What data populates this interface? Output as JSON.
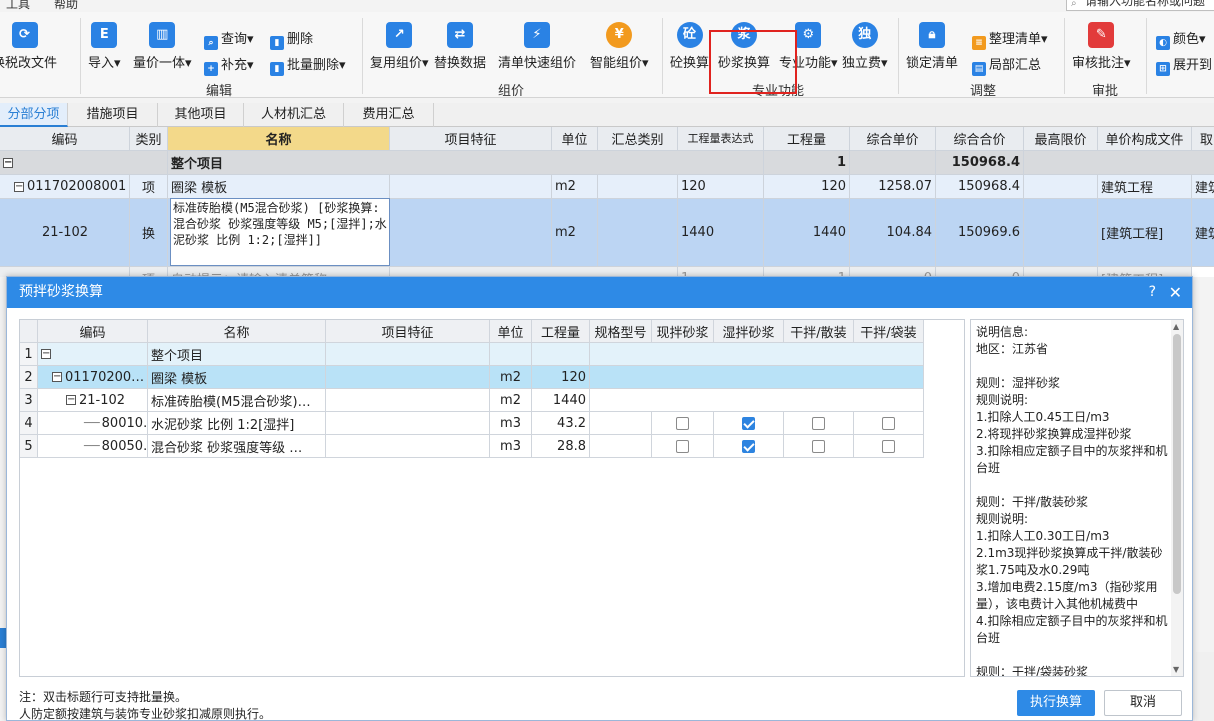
{
  "menu": {
    "items": [
      "工具",
      "帮助"
    ],
    "search_placeholder": "请输入功能名称或问题"
  },
  "ribbon": {
    "buttons": {
      "tax": "换税改文件",
      "import": "导入",
      "unit_price": "量价一体",
      "query": "查询",
      "delete": "删除",
      "supplement": "补充",
      "batch_delete": "批量删除",
      "reuse": "复用组价",
      "replace": "替换数据",
      "quick": "清单快速组价",
      "smart": "智能组价",
      "concrete": "砼换算",
      "mortar": "砂浆换算",
      "pro": "专业功能",
      "indep": "独立费",
      "lock": "锁定清单",
      "organize": "整理清单",
      "partial": "局部汇总",
      "review": "审核批注",
      "color": "颜色",
      "expand": "展开到"
    },
    "groups": {
      "edit": "编辑",
      "pricing": "组价",
      "pro": "专业功能",
      "adjust": "调整",
      "review": "审批"
    }
  },
  "tabs": [
    "分部分项",
    "措施项目",
    "其他项目",
    "人材机汇总",
    "费用汇总"
  ],
  "grid": {
    "headers": {
      "code": "编码",
      "category": "类别",
      "name": "名称",
      "feature": "项目特征",
      "unit": "单位",
      "sum_cat": "汇总类别",
      "expr": "工程量表达式",
      "qty": "工程量",
      "unit_price": "综合单价",
      "total": "综合合价",
      "max_price": "最高限价",
      "template": "单价构成文件",
      "extra": "取"
    },
    "whole": {
      "name": "整个项目",
      "qty": "1",
      "total": "150968.4"
    },
    "item": {
      "code": "011702008001",
      "cat": "项",
      "name": "圈梁 模板",
      "unit": "m2",
      "expr": "120",
      "qty": "120",
      "price": "1258.07",
      "total": "150968.4",
      "template": "建筑工程",
      "extra": "建筑"
    },
    "sub": {
      "code": "21-102",
      "cat": "换",
      "name": "标准砖胎模(M5混合砂浆) [砂浆换算:混合砂浆 砂浆强度等级 M5;[湿拌];水泥砂浆 比例 1:2;[湿拌]]",
      "unit": "m2",
      "expr": "1440",
      "qty": "1440",
      "price": "104.84",
      "total": "150969.6",
      "template": "[建筑工程]",
      "extra": "建筑"
    },
    "next": {
      "cat": "项",
      "name": "自动提示：请输入清单简称",
      "expr": "1",
      "qty": "1",
      "price": "0",
      "total": "0",
      "template": "[建筑工程]"
    }
  },
  "dialog": {
    "title": "预拌砂浆换算",
    "help": "?",
    "close": "✕",
    "headers": [
      "编码",
      "名称",
      "项目特征",
      "单位",
      "工程量",
      "规格型号",
      "现拌砂浆",
      "湿拌砂浆",
      "干拌/散装",
      "干拌/袋装"
    ],
    "rows": [
      {
        "n": "1",
        "code": "",
        "name": "整个项目",
        "unit": "",
        "qty": ""
      },
      {
        "n": "2",
        "code": "01170200…",
        "name": "圈梁 模板",
        "unit": "m2",
        "qty": "120"
      },
      {
        "n": "3",
        "code": "21-102",
        "name": "标准砖胎模(M5混合砂浆)…",
        "unit": "m2",
        "qty": "1440"
      },
      {
        "n": "4",
        "code": "80010…",
        "name": "水泥砂浆 比例 1:2[湿拌]",
        "unit": "m3",
        "qty": "43.2"
      },
      {
        "n": "5",
        "code": "80050…",
        "name": "混合砂浆 砂浆强度等级 …",
        "unit": "m3",
        "qty": "28.8"
      }
    ],
    "checks": [
      [
        false,
        true,
        false,
        false
      ],
      [
        false,
        true,
        false,
        false
      ]
    ],
    "info": "说明信息:\n地区：江苏省\n\n规则：湿拌砂浆\n规则说明:\n1.扣除人工0.45工日/m3\n2.将现拌砂浆换算成湿拌砂浆\n3.扣除相应定额子目中的灰浆拌和机台班\n\n规则：干拌/散装砂浆\n规则说明:\n1.扣除人工0.30工日/m3\n2.1m3现拌砂浆换算成干拌/散装砂浆1.75吨及水0.29吨\n3.增加电费2.15度/m3（指砂浆用量），该电费计入其他机械费中\n4.扣除相应定额子目中的灰浆拌和机台班\n\n规则：干拌/袋装砂浆",
    "note1": "注：双击标题行可支持批量换。",
    "note2": "人防定额按建筑与装饰专业砂浆扣减原则执行。",
    "execute": "执行换算",
    "cancel": "取消"
  }
}
